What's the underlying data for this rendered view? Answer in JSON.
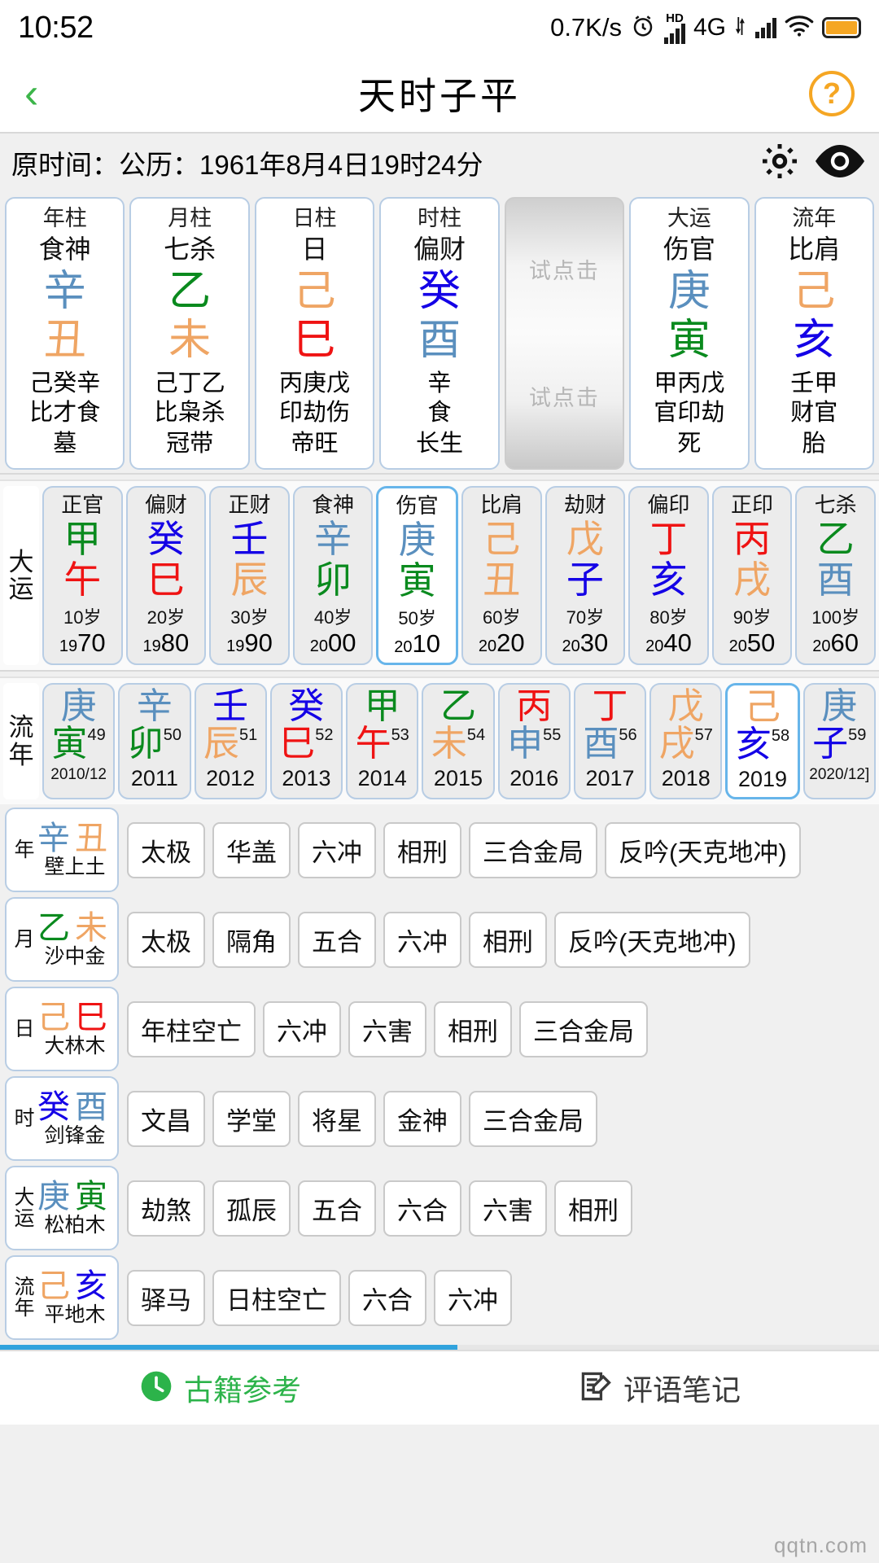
{
  "status_bar": {
    "time": "10:52",
    "net_speed": "0.7K/s",
    "alarm_icon": "alarm-clock-icon",
    "hd_label": "HD",
    "network_type": "4G",
    "wifi_icon": "wifi-icon",
    "battery_icon": "battery-icon"
  },
  "title_bar": {
    "back_icon": "chevron-left-icon",
    "title": "天时子平",
    "help_label": "?"
  },
  "date_bar": {
    "text": "原时间：公历：1961年8月4日19时24分",
    "settings_icon": "gear-icon",
    "eye_icon": "eye-icon"
  },
  "pillars": [
    {
      "head": "年柱",
      "god": "食神",
      "stem": "辛",
      "stem_el": "metal",
      "branch": "丑",
      "branch_el": "earth",
      "hidden": "己癸辛",
      "hidden_gods": "比才食",
      "stage": "墓",
      "placeholder": false
    },
    {
      "head": "月柱",
      "god": "七杀",
      "stem": "乙",
      "stem_el": "wood",
      "branch": "未",
      "branch_el": "earth",
      "hidden": "己丁乙",
      "hidden_gods": "比枭杀",
      "stage": "冠带",
      "placeholder": false
    },
    {
      "head": "日柱",
      "god": "日",
      "stem": "己",
      "stem_el": "earth",
      "branch": "巳",
      "branch_el": "fire",
      "hidden": "丙庚戊",
      "hidden_gods": "印劫伤",
      "stage": "帝旺",
      "placeholder": false
    },
    {
      "head": "时柱",
      "god": "偏财",
      "stem": "癸",
      "stem_el": "water",
      "branch": "酉",
      "branch_el": "metal",
      "hidden": "辛",
      "hidden_gods": "食",
      "stage": "长生",
      "placeholder": false
    },
    {
      "placeholder": true,
      "hint_top": "试点击",
      "hint_bottom": "试点击"
    },
    {
      "head": "大运",
      "god": "伤官",
      "stem": "庚",
      "stem_el": "metal",
      "branch": "寅",
      "branch_el": "wood",
      "hidden": "甲丙戊",
      "hidden_gods": "官印劫",
      "stage": "死",
      "placeholder": false
    },
    {
      "head": "流年",
      "god": "比肩",
      "stem": "己",
      "stem_el": "earth",
      "branch": "亥",
      "branch_el": "water",
      "hidden": "壬甲",
      "hidden_gods": "财官",
      "stage": "胎",
      "placeholder": false
    }
  ],
  "dayun": {
    "label": "大运",
    "items": [
      {
        "god": "正官",
        "stem": "甲",
        "stem_el": "wood",
        "branch": "午",
        "branch_el": "fire",
        "age": "10岁",
        "year_pre": "19",
        "year_post": "70",
        "active": false
      },
      {
        "god": "偏财",
        "stem": "癸",
        "stem_el": "water",
        "branch": "巳",
        "branch_el": "fire",
        "age": "20岁",
        "year_pre": "19",
        "year_post": "80",
        "active": false
      },
      {
        "god": "正财",
        "stem": "壬",
        "stem_el": "water",
        "branch": "辰",
        "branch_el": "earth",
        "age": "30岁",
        "year_pre": "19",
        "year_post": "90",
        "active": false
      },
      {
        "god": "食神",
        "stem": "辛",
        "stem_el": "metal",
        "branch": "卯",
        "branch_el": "wood",
        "age": "40岁",
        "year_pre": "20",
        "year_post": "00",
        "active": false
      },
      {
        "god": "伤官",
        "stem": "庚",
        "stem_el": "metal",
        "branch": "寅",
        "branch_el": "wood",
        "age": "50岁",
        "year_pre": "20",
        "year_post": "10",
        "active": true
      },
      {
        "god": "比肩",
        "stem": "己",
        "stem_el": "earth",
        "branch": "丑",
        "branch_el": "earth",
        "age": "60岁",
        "year_pre": "20",
        "year_post": "20",
        "active": false
      },
      {
        "god": "劫财",
        "stem": "戊",
        "stem_el": "earth",
        "branch": "子",
        "branch_el": "water",
        "age": "70岁",
        "year_pre": "20",
        "year_post": "30",
        "active": false
      },
      {
        "god": "偏印",
        "stem": "丁",
        "stem_el": "fire",
        "branch": "亥",
        "branch_el": "water",
        "age": "80岁",
        "year_pre": "20",
        "year_post": "40",
        "active": false
      },
      {
        "god": "正印",
        "stem": "丙",
        "stem_el": "fire",
        "branch": "戌",
        "branch_el": "earth",
        "age": "90岁",
        "year_pre": "20",
        "year_post": "50",
        "active": false
      },
      {
        "god": "七杀",
        "stem": "乙",
        "stem_el": "wood",
        "branch": "酉",
        "branch_el": "metal",
        "age": "100岁",
        "year_pre": "20",
        "year_post": "60",
        "active": false
      }
    ]
  },
  "liunian": {
    "label": "流年",
    "items": [
      {
        "stem": "庚",
        "stem_el": "metal",
        "branch": "寅",
        "branch_el": "wood",
        "sup": "49",
        "year": "2010/12",
        "small": true,
        "active": false
      },
      {
        "stem": "辛",
        "stem_el": "metal",
        "branch": "卯",
        "branch_el": "wood",
        "sup": "50",
        "year": "2011",
        "small": false,
        "active": false
      },
      {
        "stem": "壬",
        "stem_el": "water",
        "branch": "辰",
        "branch_el": "earth",
        "sup": "51",
        "year": "2012",
        "small": false,
        "active": false
      },
      {
        "stem": "癸",
        "stem_el": "water",
        "branch": "巳",
        "branch_el": "fire",
        "sup": "52",
        "year": "2013",
        "small": false,
        "active": false
      },
      {
        "stem": "甲",
        "stem_el": "wood",
        "branch": "午",
        "branch_el": "fire",
        "sup": "53",
        "year": "2014",
        "small": false,
        "active": false
      },
      {
        "stem": "乙",
        "stem_el": "wood",
        "branch": "未",
        "branch_el": "earth",
        "sup": "54",
        "year": "2015",
        "small": false,
        "active": false
      },
      {
        "stem": "丙",
        "stem_el": "fire",
        "branch": "申",
        "branch_el": "metal",
        "sup": "55",
        "year": "2016",
        "small": false,
        "active": false
      },
      {
        "stem": "丁",
        "stem_el": "fire",
        "branch": "酉",
        "branch_el": "metal",
        "sup": "56",
        "year": "2017",
        "small": false,
        "active": false
      },
      {
        "stem": "戊",
        "stem_el": "earth",
        "branch": "戌",
        "branch_el": "earth",
        "sup": "57",
        "year": "2018",
        "small": false,
        "active": false
      },
      {
        "stem": "己",
        "stem_el": "earth",
        "branch": "亥",
        "branch_el": "water",
        "sup": "58",
        "year": "2019",
        "small": false,
        "active": true
      },
      {
        "stem": "庚",
        "stem_el": "metal",
        "branch": "子",
        "branch_el": "water",
        "sup": "59",
        "year": "2020/12]",
        "small": true,
        "active": false
      }
    ]
  },
  "relations": [
    {
      "tag": "年",
      "stem": "辛",
      "stem_el": "metal",
      "branch": "丑",
      "branch_el": "earth",
      "nayin": "壁上土",
      "chips": [
        "太极",
        "华盖",
        "六冲",
        "相刑",
        "三合金局",
        "反吟(天克地冲)"
      ]
    },
    {
      "tag": "月",
      "stem": "乙",
      "stem_el": "wood",
      "branch": "未",
      "branch_el": "earth",
      "nayin": "沙中金",
      "chips": [
        "太极",
        "隔角",
        "五合",
        "六冲",
        "相刑",
        "反吟(天克地冲)"
      ]
    },
    {
      "tag": "日",
      "stem": "己",
      "stem_el": "earth",
      "branch": "巳",
      "branch_el": "fire",
      "nayin": "大林木",
      "chips": [
        "年柱空亡",
        "六冲",
        "六害",
        "相刑",
        "三合金局"
      ]
    },
    {
      "tag": "时",
      "stem": "癸",
      "stem_el": "water",
      "branch": "酉",
      "branch_el": "metal",
      "nayin": "剑锋金",
      "chips": [
        "文昌",
        "学堂",
        "将星",
        "金神",
        "三合金局"
      ]
    },
    {
      "tag": "大运",
      "stem": "庚",
      "stem_el": "metal",
      "branch": "寅",
      "branch_el": "wood",
      "nayin": "松柏木",
      "chips": [
        "劫煞",
        "孤辰",
        "五合",
        "六合",
        "六害",
        "相刑"
      ]
    },
    {
      "tag": "流年",
      "stem": "己",
      "stem_el": "earth",
      "branch": "亥",
      "branch_el": "water",
      "nayin": "平地木",
      "chips": [
        "驿马",
        "日柱空亡",
        "六合",
        "六冲"
      ]
    }
  ],
  "bottom_bar": {
    "left_icon": "clock-icon",
    "left_label": "古籍参考",
    "right_icon": "note-edit-icon",
    "right_label": "评语笔记"
  },
  "watermark": "qqtn.com"
}
